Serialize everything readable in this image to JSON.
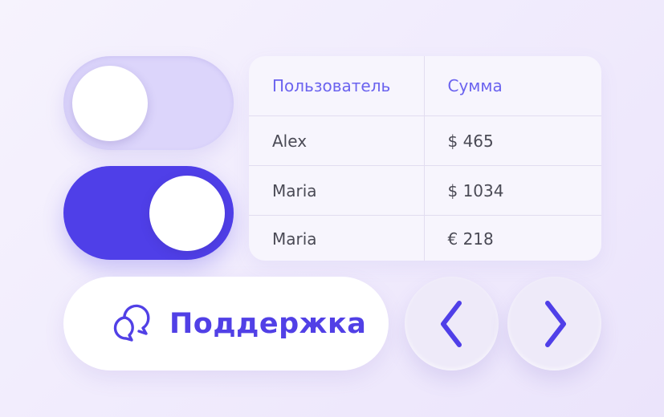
{
  "colors": {
    "accent": "#4f3fe8",
    "toggle_off": "#dcd5fb",
    "header_text": "#6b63ef",
    "cell_text": "#4a4a55",
    "support_text": "#5140e6"
  },
  "toggles": [
    {
      "state": "off"
    },
    {
      "state": "on"
    }
  ],
  "table": {
    "headers": [
      "Пользователь",
      "Сумма"
    ],
    "rows": [
      [
        "Alex",
        "$ 465"
      ],
      [
        "Maria",
        "$ 1034"
      ],
      [
        "Maria",
        "€ 218"
      ]
    ]
  },
  "support": {
    "icon": "chat-bubbles-icon",
    "label": "Поддержка"
  },
  "nav": {
    "prev_icon": "chevron-left-icon",
    "next_icon": "chevron-right-icon"
  }
}
